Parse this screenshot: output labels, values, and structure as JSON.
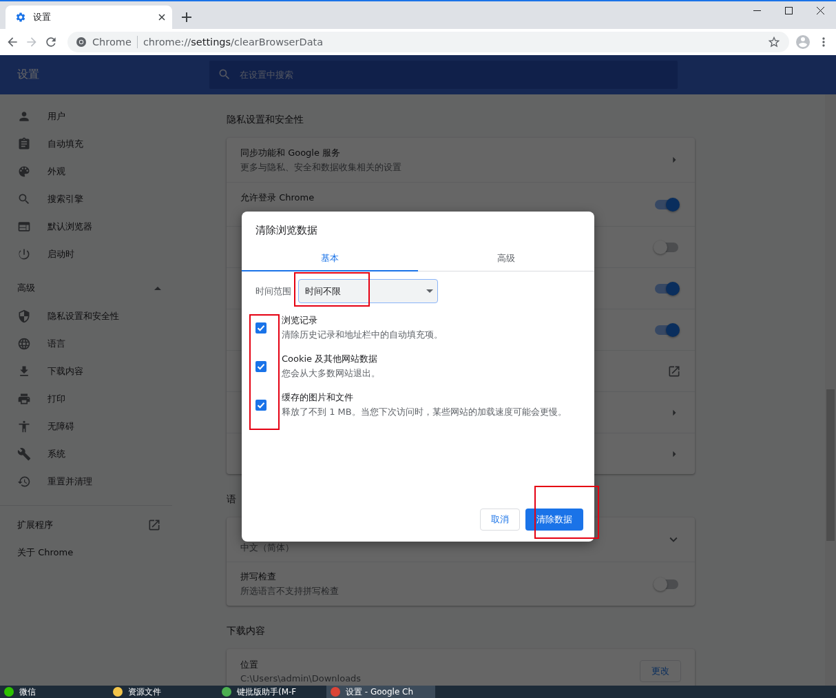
{
  "browser": {
    "tab": {
      "title": "设置"
    },
    "address": {
      "site": "Chrome",
      "scheme": "chrome://",
      "host": "settings",
      "path": "/clearBrowserData"
    }
  },
  "header": {
    "title": "设置",
    "search": {
      "placeholder": "在设置中搜索"
    }
  },
  "sidebar": {
    "items": [
      {
        "label": "用户"
      },
      {
        "label": "自动填充"
      },
      {
        "label": "外观"
      },
      {
        "label": "搜索引擎"
      },
      {
        "label": "默认浏览器"
      },
      {
        "label": "启动时"
      }
    ],
    "advanced": {
      "label": "高级",
      "expanded": true,
      "items": [
        {
          "label": "隐私设置和安全性"
        },
        {
          "label": "语言"
        },
        {
          "label": "下载内容"
        },
        {
          "label": "打印"
        },
        {
          "label": "无障碍"
        },
        {
          "label": "系统"
        },
        {
          "label": "重置并清理"
        }
      ]
    },
    "extensions": "扩展程序",
    "about": "关于 Chrome"
  },
  "privacy": {
    "title": "隐私设置和安全性",
    "rows": [
      {
        "kind": "arrow",
        "title": "同步功能和 Google 服务",
        "subtitle": "更多与隐私、安全和数据收集相关的设置"
      },
      {
        "kind": "toggle",
        "title": "允许登录 Chrome",
        "on": true
      },
      {
        "kind": "toggle",
        "on": false
      },
      {
        "kind": "toggle",
        "on": true
      },
      {
        "kind": "toggle",
        "on": true
      },
      {
        "kind": "external"
      },
      {
        "kind": "arrow"
      },
      {
        "kind": "arrow"
      }
    ]
  },
  "languages": {
    "title": "语",
    "rows": [
      {
        "kind": "expand",
        "subtitle": "中文（简体）"
      },
      {
        "kind": "toggle",
        "title": "拼写检查",
        "subtitle": "所选语言不支持拼写检查",
        "on": false
      }
    ]
  },
  "downloads": {
    "title": "下载内容",
    "location": {
      "title": "位置",
      "subtitle": "C:\\Users\\admin\\Downloads",
      "button": "更改"
    }
  },
  "dialog": {
    "title": "清除浏览数据",
    "tabs": [
      {
        "label": "基本",
        "selected": true
      },
      {
        "label": "高级",
        "selected": false
      }
    ],
    "time_range": {
      "label": "时间范围",
      "value": "时间不限"
    },
    "items": [
      {
        "title": "浏览记录",
        "subtitle": "清除历史记录和地址栏中的自动填充项。",
        "checked": true
      },
      {
        "title": "Cookie 及其他网站数据",
        "subtitle": "您会从大多数网站退出。",
        "checked": true
      },
      {
        "title": "缓存的图片和文件",
        "subtitle": "释放了不到 1 MB。当您下次访问时，某些网站的加载速度可能会更慢。",
        "checked": true
      }
    ],
    "buttons": {
      "cancel": "取消",
      "confirm": "清除数据"
    }
  },
  "taskbar": {
    "items": [
      {
        "label": "微信",
        "selected": false
      },
      {
        "label": "资源文件",
        "selected": false
      },
      {
        "label": "键批版助手(M-F",
        "selected": false
      },
      {
        "label": "设置 - Google Ch",
        "selected": true
      }
    ]
  }
}
